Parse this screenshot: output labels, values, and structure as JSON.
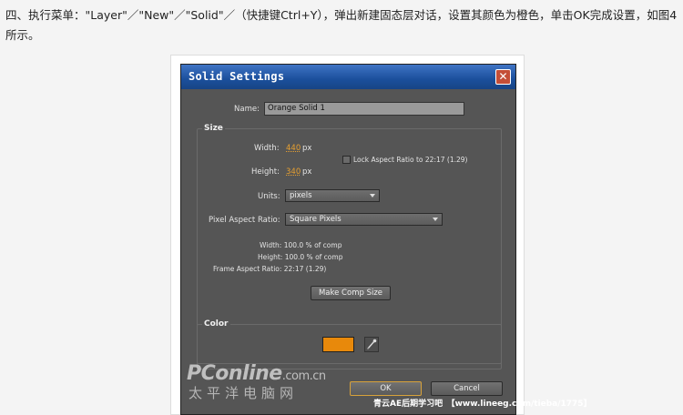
{
  "intro_text": "四、执行菜单：\"Layer\"／\"New\"／\"Solid\"／（快捷键Ctrl+Y），弹出新建固态层对话，设置其颜色为橙色，单击OK完成设置，如图4所示。",
  "dialog": {
    "title": "Solid Settings",
    "close_glyph": "✕",
    "name_label": "Name:",
    "name_value": "Orange Solid 1",
    "size_group": "Size",
    "width_label": "Width:",
    "width_value": "440",
    "height_label": "Height:",
    "height_value": "340",
    "px_unit": "px",
    "lock_aspect_label": "Lock Aspect Ratio to 22:17 (1.29)",
    "lock_aspect_checked": false,
    "units_label": "Units:",
    "units_value": "pixels",
    "par_label": "Pixel Aspect Ratio:",
    "par_value": "Square Pixels",
    "info_width": "Width: 100.0 % of comp",
    "info_height": "Height: 100.0 % of comp",
    "info_far": "Frame Aspect Ratio: 22:17 (1.29)",
    "make_comp_size": "Make Comp Size",
    "color_group": "Color",
    "color_value": "#e8890b",
    "eyedropper_icon": "eyedropper-icon",
    "ok_label": "OK",
    "cancel_label": "Cancel"
  },
  "watermark": {
    "pconline": "PConline",
    "pconline_domain": ".com.cn",
    "pconline_cn": "太平洋电脑网",
    "tieba": "青云AE后期学习吧　【www.lineeg.com/tieba/1775】"
  }
}
